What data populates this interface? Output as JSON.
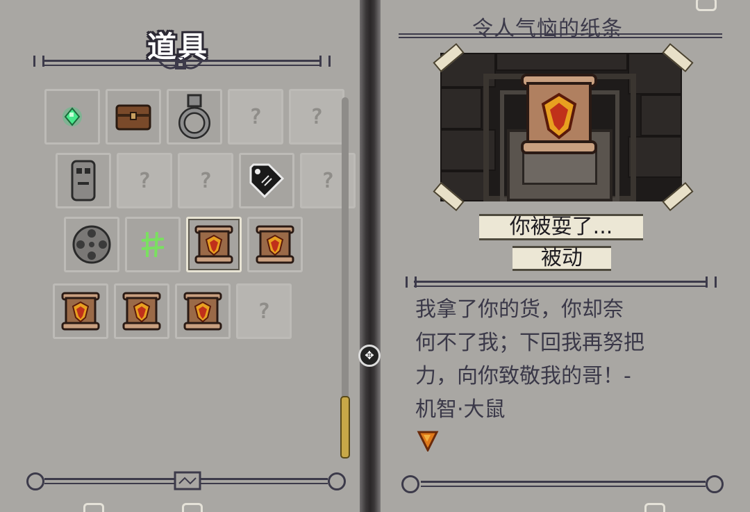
{
  "inventory": {
    "title": "道具",
    "rows": [
      [
        {
          "icon": "green-gem-icon",
          "unknown": false
        },
        {
          "icon": "treasure-chest-icon",
          "unknown": false
        },
        {
          "icon": "iron-ring-icon",
          "unknown": false
        },
        {
          "icon": "unknown-item-icon",
          "unknown": true,
          "label": "?"
        },
        {
          "icon": "unknown-item-icon",
          "unknown": true,
          "label": "?"
        }
      ],
      [
        {
          "icon": "stone-idol-icon",
          "unknown": false
        },
        {
          "icon": "unknown-item-icon",
          "unknown": true,
          "label": "?"
        },
        {
          "icon": "unknown-item-icon",
          "unknown": true,
          "label": "?"
        },
        {
          "icon": "black-tag-icon",
          "unknown": false
        },
        {
          "icon": "unknown-item-icon",
          "unknown": true,
          "label": "?"
        }
      ],
      [
        {
          "icon": "film-reel-icon",
          "unknown": false
        },
        {
          "icon": "green-rune-icon",
          "unknown": false
        },
        {
          "icon": "rat-note-scroll-icon",
          "unknown": false,
          "selected": true
        },
        {
          "icon": "rat-note-scroll-icon",
          "unknown": false
        }
      ],
      [
        {
          "icon": "rat-note-scroll-icon",
          "unknown": false
        },
        {
          "icon": "rat-note-scroll-icon",
          "unknown": false
        },
        {
          "icon": "rat-note-scroll-icon",
          "unknown": false
        },
        {
          "icon": "unknown-item-icon",
          "unknown": true,
          "label": "?"
        }
      ]
    ]
  },
  "detail": {
    "name": "令人气恼的纸条",
    "quote": "你被耍了...",
    "type": "被动",
    "description": [
      "我拿了你的货，你却奈",
      "何不了我；下回我再努把",
      "力，向你致敬我的哥！-",
      "机智·大鼠"
    ],
    "quality_icon": "quality-d-icon"
  },
  "colors": {
    "page": "#a9a7a3",
    "ink": "#3c3a4a",
    "scroll": "#8a5a3a",
    "flame": "#e07a1a"
  }
}
